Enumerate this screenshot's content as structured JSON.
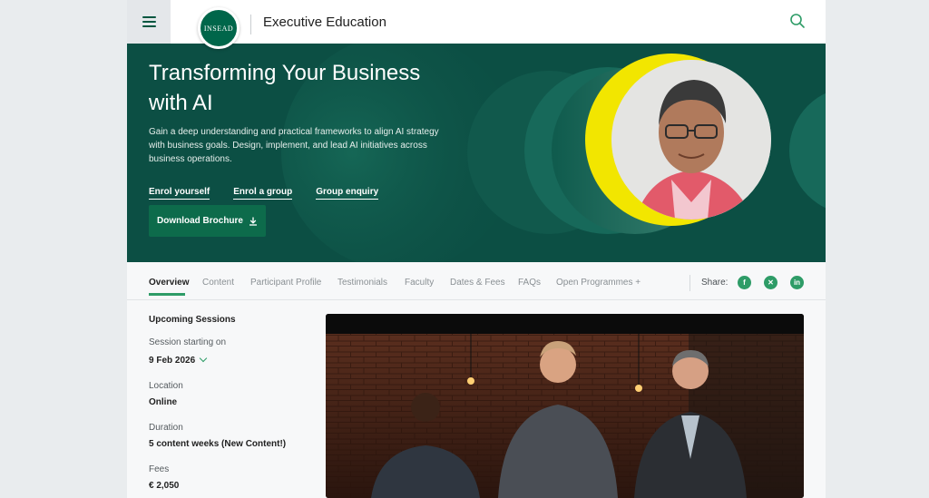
{
  "header": {
    "logo_text": "INSEAD",
    "title": "Executive Education",
    "menu_icon": "hamburger-icon",
    "search_icon": "search-icon"
  },
  "hero": {
    "title": "Transforming Your Business with AI",
    "description": "Gain a deep understanding and practical frameworks to align AI strategy with business goals. Design, implement, and lead AI initiatives across business operations.",
    "links": [
      "Enrol yourself",
      "Enrol a group",
      "Group enquiry"
    ],
    "brochure_label": "Download Brochure",
    "brochure_icon": "download-icon",
    "colors": {
      "background": "#0c4f44",
      "accent_ring": "#f2e600",
      "button": "#0d6b4b"
    }
  },
  "tabs": {
    "items": [
      "Overview",
      "Content",
      "Participant Profile",
      "Testimonials",
      "Faculty",
      "Dates & Fees",
      "FAQs",
      "Open Programmes +"
    ],
    "active": "Overview",
    "share_label": "Share:",
    "social_icons": [
      "facebook-icon",
      "x-icon",
      "linkedin-icon"
    ]
  },
  "sessions": {
    "heading": "Upcoming Sessions",
    "start_label": "Session starting on",
    "start_value": "9 Feb 2026",
    "location_label": "Location",
    "location_value": "Online",
    "duration_label": "Duration",
    "duration_value": "5 content weeks (New Content!)",
    "fees_label": "Fees",
    "fees_value": "€ 2,050"
  }
}
